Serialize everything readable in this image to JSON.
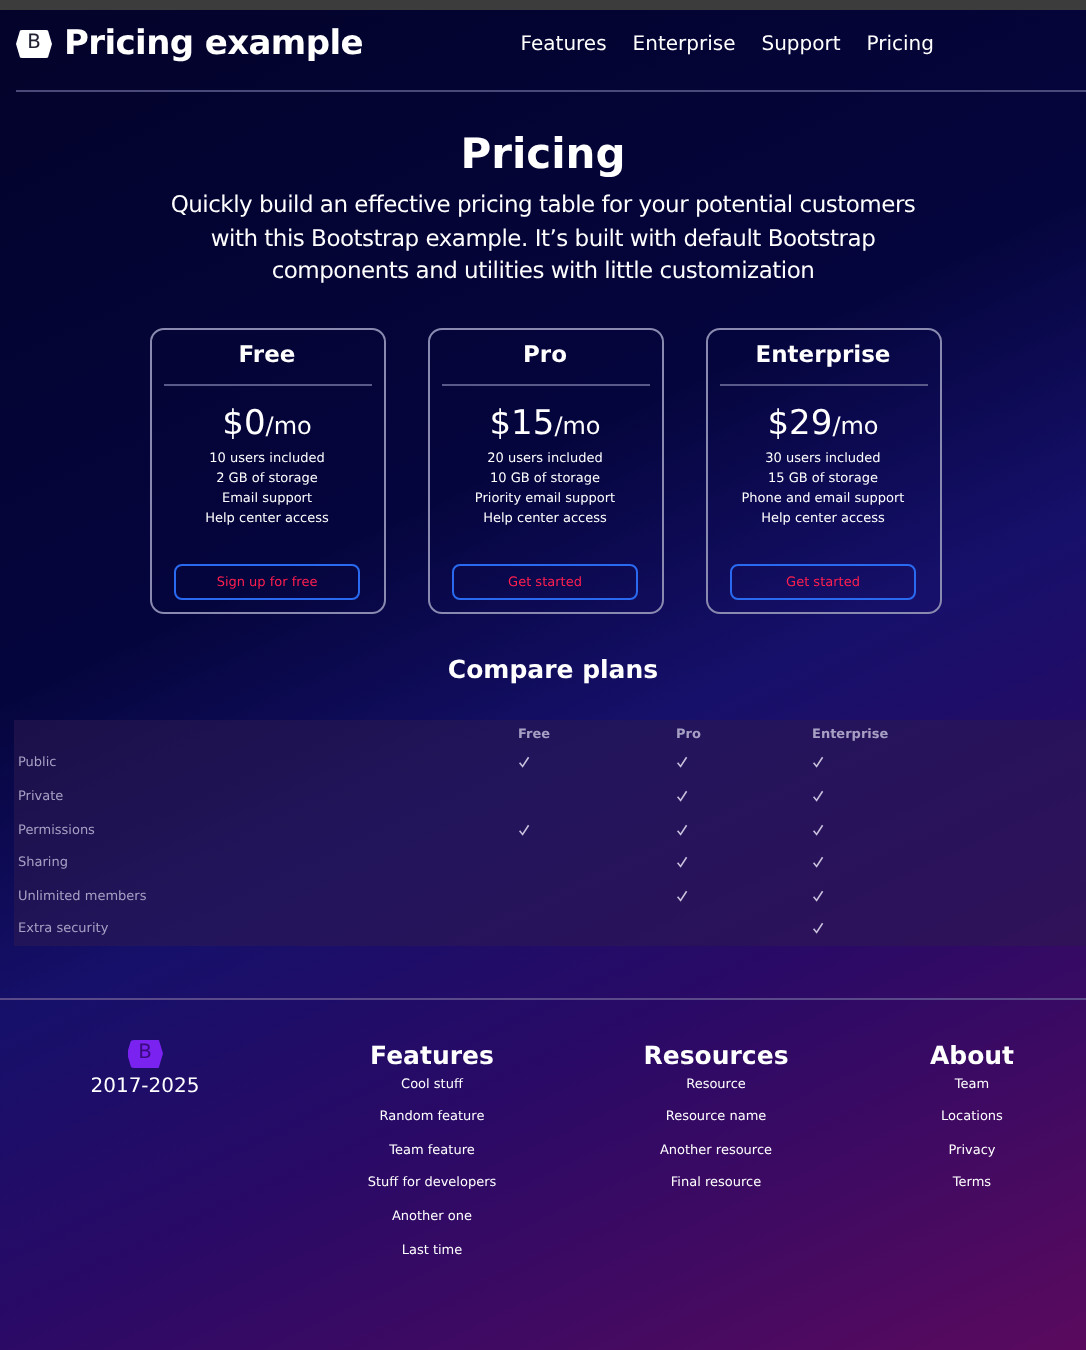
{
  "header": {
    "logo_mark": "B",
    "title": "Pricing example",
    "nav": [
      {
        "label": "Features"
      },
      {
        "label": "Enterprise"
      },
      {
        "label": "Support"
      },
      {
        "label": "Pricing"
      }
    ]
  },
  "hero": {
    "title": "Pricing",
    "lead": "Quickly build an effective pricing table for your potential customers with this Bootstrap example. It’s built with default Bootstrap components and utilities with little customization"
  },
  "plans": [
    {
      "name": "Free",
      "price": "$0",
      "period": "/mo",
      "features": [
        "10 users included",
        "2 GB of storage",
        "Email support",
        "Help center access"
      ],
      "button": "Sign up for free"
    },
    {
      "name": "Pro",
      "price": "$15",
      "period": "/mo",
      "features": [
        "20 users included",
        "10 GB of storage",
        "Priority email support",
        "Help center access"
      ],
      "button": "Get started"
    },
    {
      "name": "Enterprise",
      "price": "$29",
      "period": "/mo",
      "features": [
        "30 users included",
        "15 GB of storage",
        "Phone and email support",
        "Help center access"
      ],
      "button": "Get started"
    }
  ],
  "compare": {
    "title": "Compare plans",
    "columns": [
      "Free",
      "Pro",
      "Enterprise"
    ],
    "rows": [
      {
        "feature": "Public",
        "checks": [
          true,
          true,
          true
        ]
      },
      {
        "feature": "Private",
        "checks": [
          false,
          true,
          true
        ]
      },
      {
        "feature": "Permissions",
        "checks": [
          true,
          true,
          true
        ]
      },
      {
        "feature": "Sharing",
        "checks": [
          false,
          true,
          true
        ]
      },
      {
        "feature": "Unlimited members",
        "checks": [
          false,
          true,
          true
        ]
      },
      {
        "feature": "Extra security",
        "checks": [
          false,
          false,
          true
        ]
      }
    ]
  },
  "footer": {
    "logo_mark": "B",
    "years": "2017-2025",
    "columns": [
      {
        "title": "Features",
        "links": [
          "Cool stuff",
          "Random feature",
          "Team feature",
          "Stuff for developers",
          "Another one",
          "Last time"
        ]
      },
      {
        "title": "Resources",
        "links": [
          "Resource",
          "Resource name",
          "Another resource",
          "Final resource"
        ]
      },
      {
        "title": "About",
        "links": [
          "Team",
          "Locations",
          "Privacy",
          "Terms"
        ]
      }
    ]
  }
}
